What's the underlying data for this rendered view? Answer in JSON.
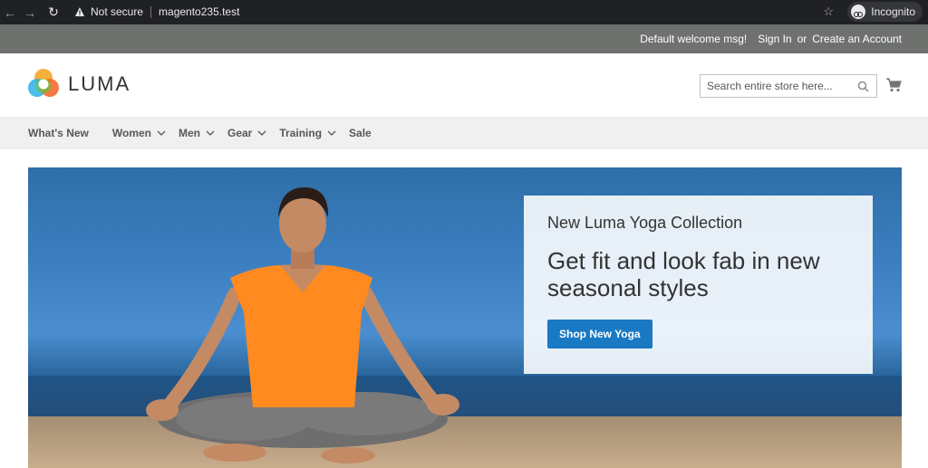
{
  "browser": {
    "security_label": "Not secure",
    "url": "magento235.test",
    "incognito_label": "Incognito"
  },
  "header_panel": {
    "welcome": "Default welcome msg!",
    "sign_in": "Sign In",
    "or": "or",
    "create_account": "Create an Account"
  },
  "logo": {
    "text": "LUMA"
  },
  "search": {
    "placeholder": "Search entire store here..."
  },
  "nav": {
    "items": [
      {
        "label": "What's New"
      },
      {
        "label": "Women"
      },
      {
        "label": "Men"
      },
      {
        "label": "Gear"
      },
      {
        "label": "Training"
      },
      {
        "label": "Sale"
      }
    ]
  },
  "hero": {
    "subtitle": "New Luma Yoga Collection",
    "title": "Get fit and look fab in new seasonal styles",
    "button": "Shop New Yoga"
  },
  "colors": {
    "accent": "#1979c3",
    "panel_bg": "#6e716e",
    "nav_bg": "#f0f0f0"
  }
}
